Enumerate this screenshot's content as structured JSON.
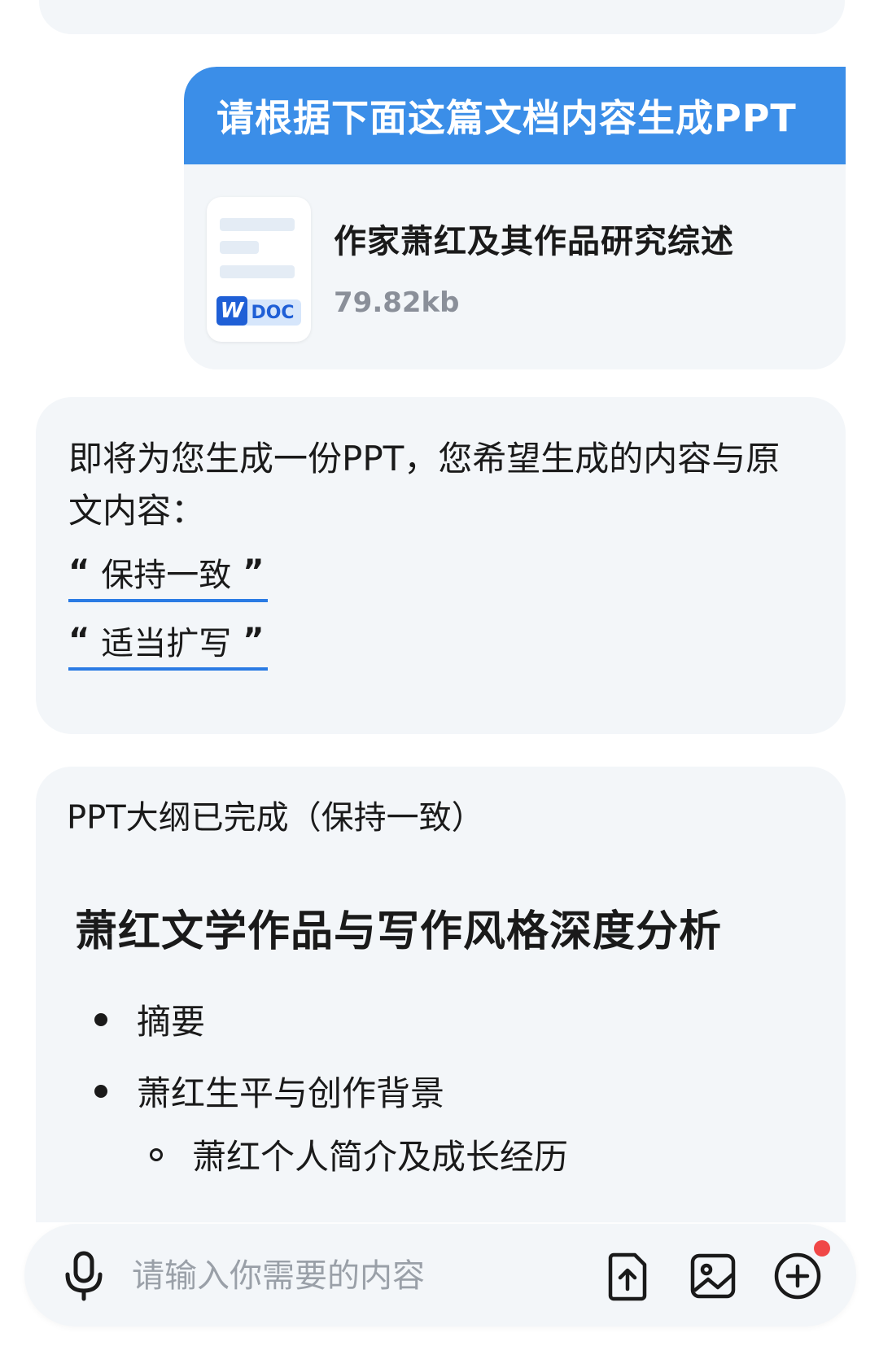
{
  "user_message": {
    "prompt": "请根据下面这篇文档内容生成PPT",
    "file": {
      "name": "作家萧红及其作品研究综述",
      "size": "79.82kb",
      "type_badge": "DOC",
      "brand_letter": "W"
    }
  },
  "bot_question": {
    "text": "即将为您生成一份PPT，您希望生成的内容与原文内容：",
    "options": [
      {
        "open_quote": "“",
        "label": "保持一致",
        "close_quote": "”"
      },
      {
        "open_quote": "“",
        "label": "适当扩写",
        "close_quote": "”"
      }
    ]
  },
  "outline": {
    "status": "PPT大纲已完成（保持一致）",
    "title": "萧红文学作品与写作风格深度分析",
    "items": [
      {
        "label": "摘要",
        "level": 1
      },
      {
        "label": "萧红生平与创作背景",
        "level": 1
      },
      {
        "label": "萧红个人简介及成长经历",
        "level": 2
      }
    ]
  },
  "input_bar": {
    "placeholder": "请输入你需要的内容"
  },
  "colors": {
    "accent": "#3b8ee8",
    "bubble_bg": "#f3f6f9",
    "notification_dot": "#f04747"
  },
  "icons": {
    "mic": "microphone-icon",
    "upload": "upload-file-icon",
    "image": "image-icon",
    "add": "add-circle-icon"
  }
}
